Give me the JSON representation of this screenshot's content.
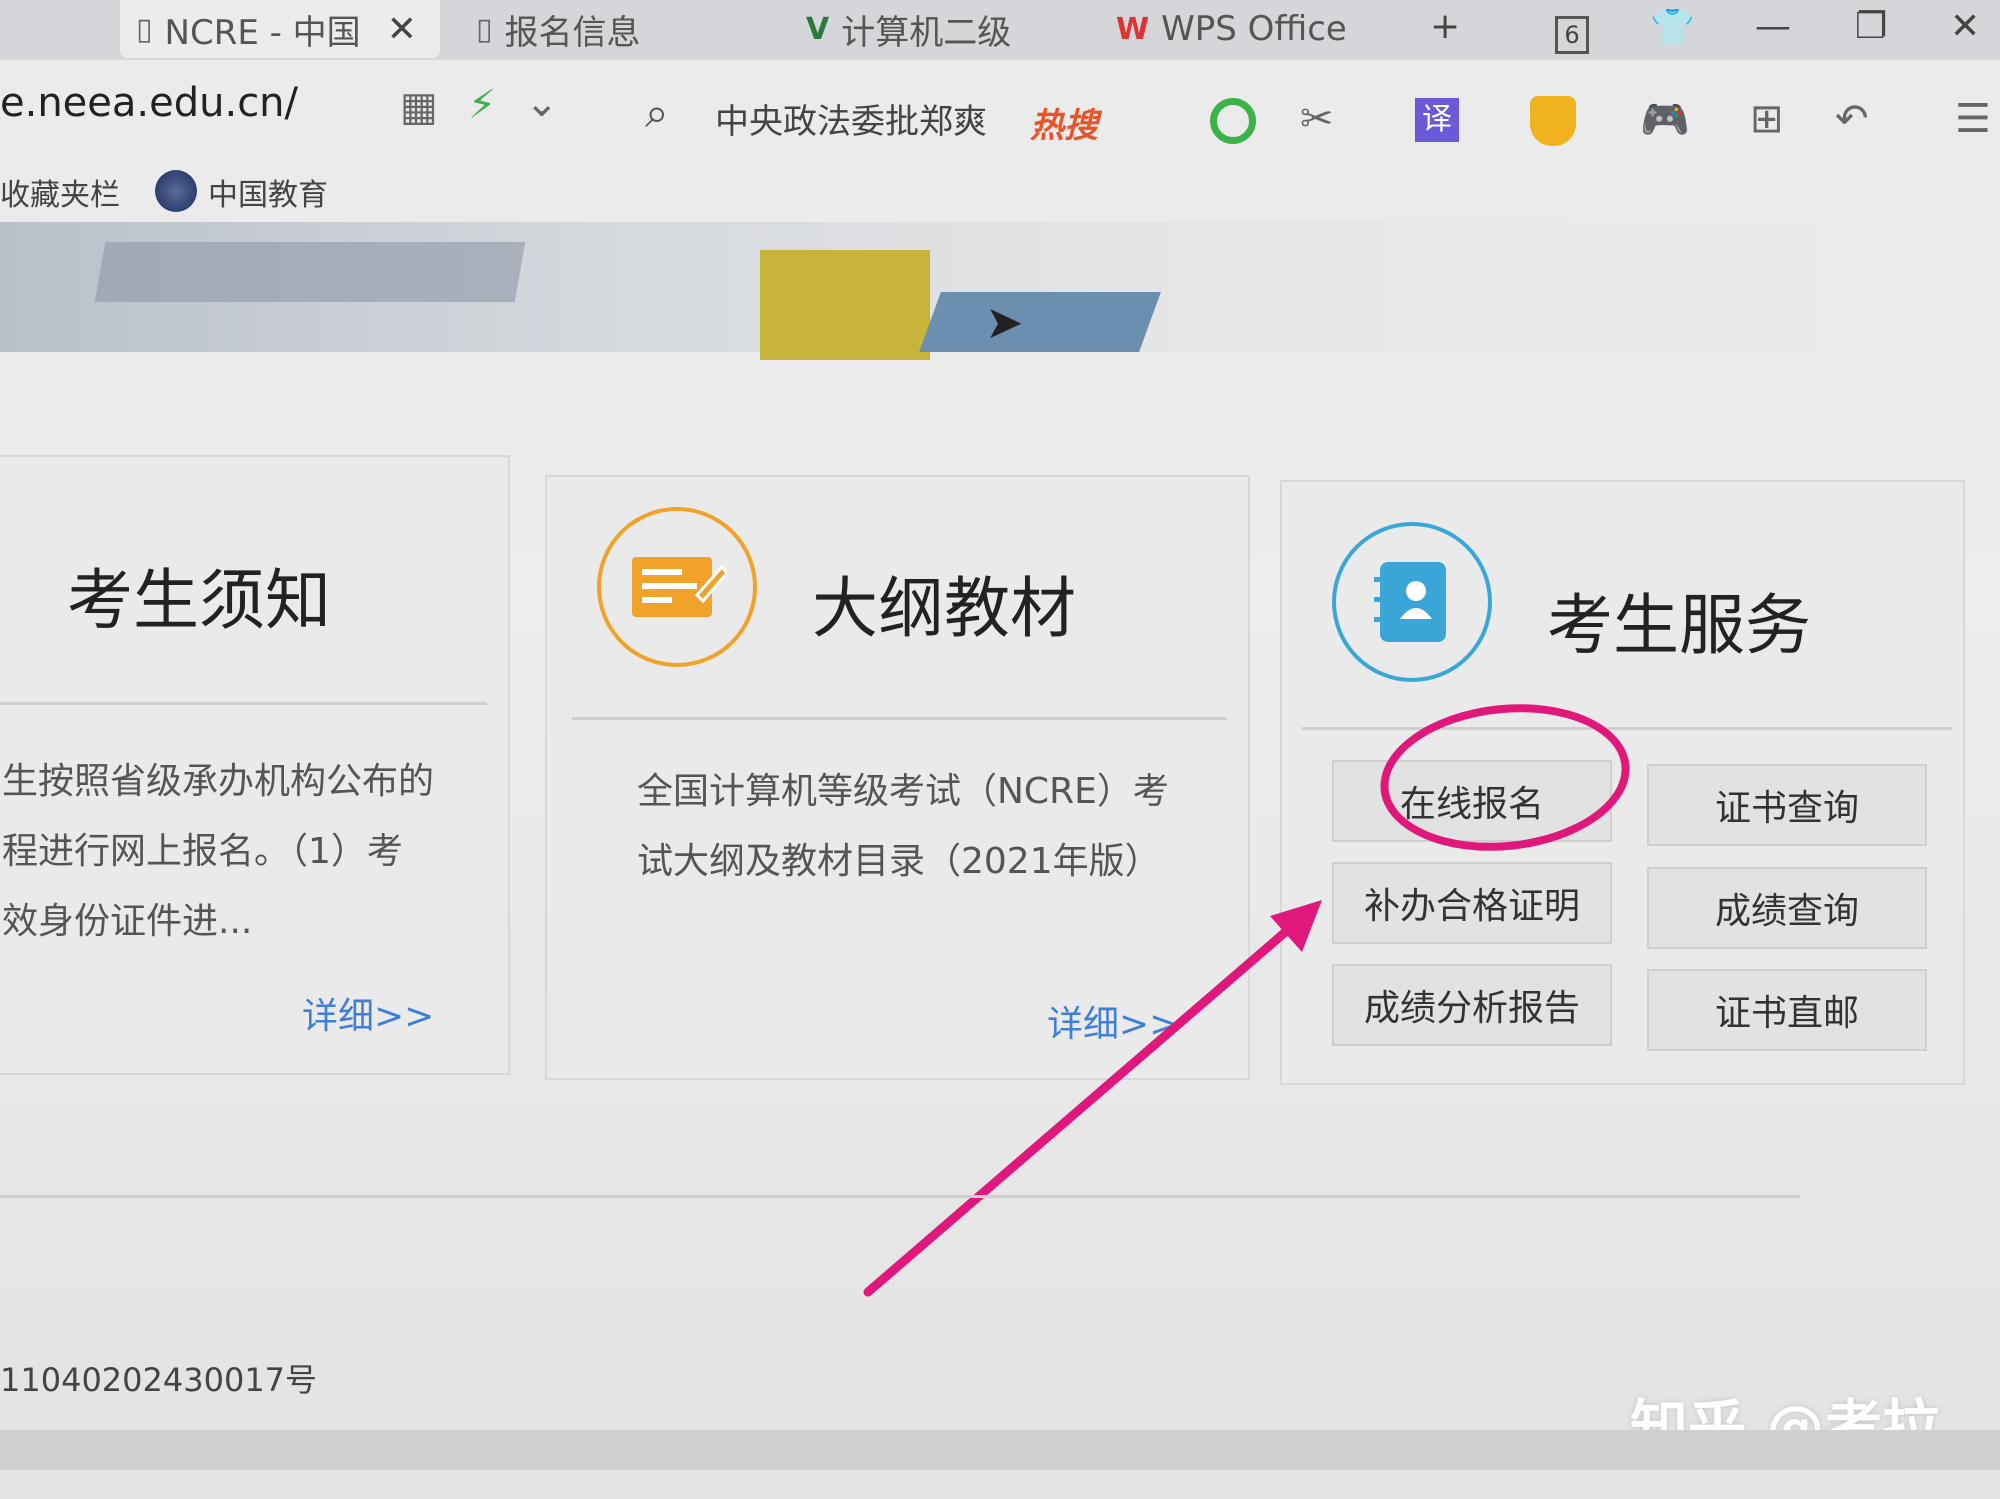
{
  "tabs": [
    {
      "label": "NCRE - 中国",
      "icon": "document-icon"
    },
    {
      "label": "报名信息",
      "icon": "document-icon"
    },
    {
      "label": "计算机二级",
      "icon": "v-logo-icon"
    },
    {
      "label": "WPS Office",
      "icon": "wps-logo-icon"
    }
  ],
  "tab_close": "✕",
  "new_tab": "+",
  "tab_count": "6",
  "address": {
    "url": "e.neea.edu.cn/",
    "hot_search_query": "中央政法委批郑爽",
    "hot_search_badge": "热搜"
  },
  "bookmarks": {
    "folder": "收藏夹栏",
    "item1": "中国教育"
  },
  "cards": {
    "notice": {
      "title": "考生须知",
      "text": [
        "生按照省级承办机构公布的",
        "程进行网上报名。（1）考",
        "效身份证件进..."
      ],
      "more": "详细>>"
    },
    "syllabus": {
      "title": "大纲教材",
      "text": [
        "全国计算机等级考试（NCRE）考",
        "试大纲及教材目录（2021年版）"
      ],
      "more": "详细>>"
    },
    "services": {
      "title": "考生服务",
      "buttons": [
        "在线报名",
        "证书查询",
        "补办合格证明",
        "成绩查询",
        "成绩分析报告",
        "证书直邮"
      ]
    }
  },
  "footer": {
    "icp": "11040202430017号"
  },
  "watermark": "知乎 @考拉",
  "colors": {
    "highlight": "#e0187c",
    "link": "#3f7fd6",
    "syllabus_icon": "#f0a22a",
    "services_icon": "#3aa6d8"
  }
}
